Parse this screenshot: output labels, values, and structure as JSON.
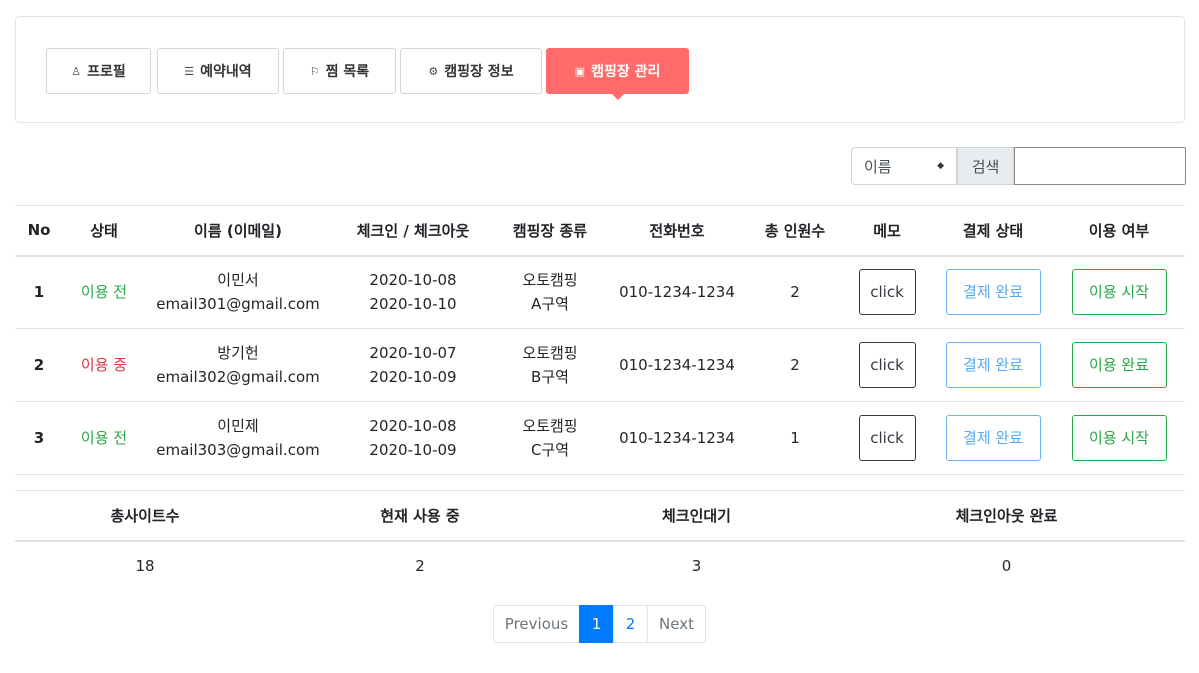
{
  "tabs": [
    {
      "label": "프로필",
      "icon": "person-icon",
      "glyph": "♙"
    },
    {
      "label": "예약내역",
      "icon": "list-icon",
      "glyph": "☰"
    },
    {
      "label": "찜 목록",
      "icon": "bookmark-icon",
      "glyph": "⚐"
    },
    {
      "label": "캠핑장 정보",
      "icon": "gear-icon",
      "glyph": "⚙"
    },
    {
      "label": "캠핑장 관리",
      "icon": "calendar-check-icon",
      "glyph": "▣"
    }
  ],
  "search": {
    "select_value": "이름",
    "label": "검색",
    "input_value": ""
  },
  "table": {
    "headers": [
      "No",
      "상태",
      "이름 (이메일)",
      "체크인 / 체크아웃",
      "캠핑장 종류",
      "전화번호",
      "총 인원수",
      "메모",
      "결제 상태",
      "이용 여부"
    ],
    "rows": [
      {
        "no": "1",
        "status": "이용 전",
        "name": "이민서",
        "email": "email301@gmail.com",
        "checkin": "2020-10-08",
        "checkout": "2020-10-10",
        "type": "오토캠핑",
        "zone": "A구역",
        "phone": "010-1234-1234",
        "people": "2",
        "memo": "click",
        "payment": "결제 완료",
        "usage": "이용 시작"
      },
      {
        "no": "2",
        "status": "이용 중",
        "name": "방기헌",
        "email": "email302@gmail.com",
        "checkin": "2020-10-07",
        "checkout": "2020-10-09",
        "type": "오토캠핑",
        "zone": "B구역",
        "phone": "010-1234-1234",
        "people": "2",
        "memo": "click",
        "payment": "결제 완료",
        "usage": "이용 완료"
      },
      {
        "no": "3",
        "status": "이용 전",
        "name": "이민제",
        "email": "email303@gmail.com",
        "checkin": "2020-10-08",
        "checkout": "2020-10-09",
        "type": "오토캠핑",
        "zone": "C구역",
        "phone": "010-1234-1234",
        "people": "1",
        "memo": "click",
        "payment": "결제 완료",
        "usage": "이용 시작"
      }
    ]
  },
  "stats": {
    "headers": [
      "총사이트수",
      "현재 사용 중",
      "체크인대기",
      "체크인아웃 완료"
    ],
    "values": [
      "18",
      "2",
      "3",
      "0"
    ]
  },
  "pagination": {
    "previous": "Previous",
    "pages": [
      "1",
      "2"
    ],
    "next": "Next"
  },
  "colors": {
    "accent": "#ff6b6b",
    "status_before": "#28a745",
    "status_during": "#dc3545",
    "primary": "#007bff"
  }
}
